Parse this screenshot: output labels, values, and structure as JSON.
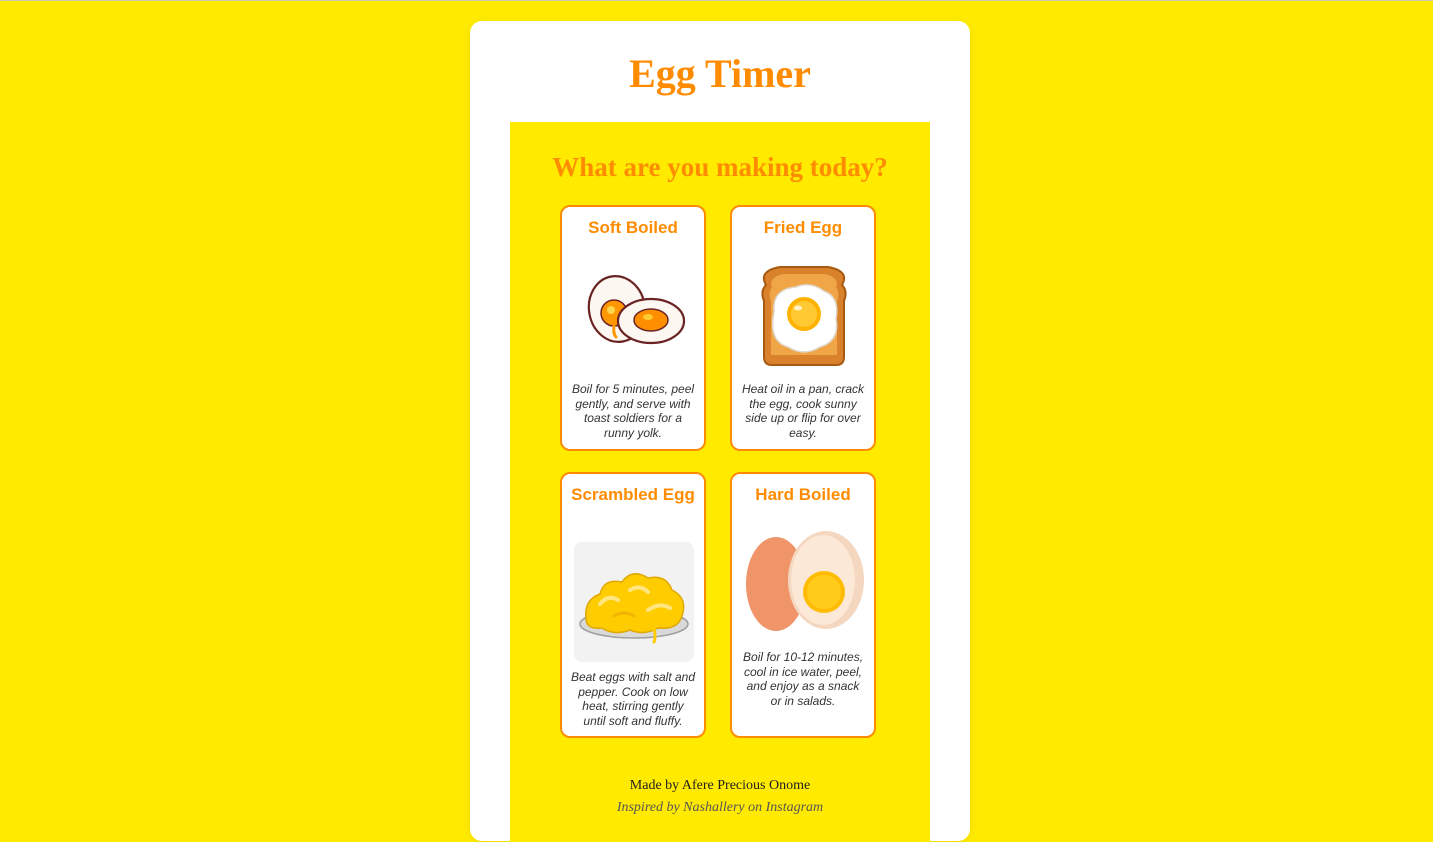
{
  "app": {
    "title": "Egg Timer",
    "heading": "What are you making today?"
  },
  "colors": {
    "background": "#ffea00",
    "accent": "#ff8c00",
    "card": "#ffffff"
  },
  "eggs": [
    {
      "name": "Soft Boiled",
      "description": "Boil for 5 minutes, peel gently, and serve with toast soldiers for a runny yolk.",
      "icon": "soft-boiled-egg-icon"
    },
    {
      "name": "Fried Egg",
      "description": "Heat oil in a pan, crack the egg, cook sunny side up or flip for over easy.",
      "icon": "fried-egg-toast-icon"
    },
    {
      "name": "Scrambled Egg",
      "description": "Beat eggs with salt and pepper. Cook on low heat, stirring gently until soft and fluffy.",
      "icon": "scrambled-egg-icon"
    },
    {
      "name": "Hard Boiled",
      "description": "Boil for 10-12 minutes, cool in ice water, peel, and enjoy as a snack or in salads.",
      "icon": "hard-boiled-egg-icon"
    }
  ],
  "footer": {
    "made_by": "Made by Afere Precious Onome",
    "inspired_by": "Inspired by Nashallery on Instagram"
  }
}
